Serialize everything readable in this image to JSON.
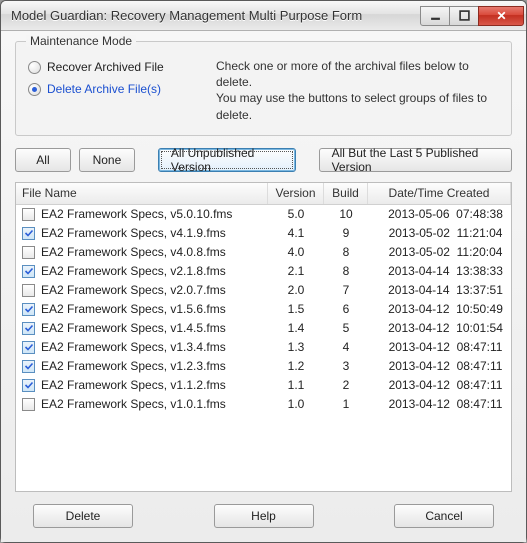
{
  "window": {
    "title": "Model Guardian: Recovery Management Multi Purpose Form"
  },
  "group": {
    "legend": "Maintenance Mode",
    "radio_recover": "Recover Archived File",
    "radio_delete": "Delete Archive File(s)",
    "selected": "delete",
    "instructions_line1": "Check one or more of the archival files below to delete.",
    "instructions_line2": "You may use the buttons to select groups of files to delete."
  },
  "filter_buttons": {
    "all": "All",
    "none": "None",
    "all_unpub": "All Unpublished Version",
    "all_but5": "All But the Last 5 Published Version"
  },
  "table": {
    "headers": {
      "filename": "File Name",
      "version": "Version",
      "build": "Build",
      "datetime": "Date/Time Created"
    },
    "rows": [
      {
        "checked": false,
        "filename": "EA2 Framework Specs, v5.0.10.fms",
        "version": "5.0",
        "build": "10",
        "datetime": "2013-05-06  07:48:38"
      },
      {
        "checked": true,
        "filename": "EA2 Framework Specs, v4.1.9.fms",
        "version": "4.1",
        "build": "9",
        "datetime": "2013-05-02  11:21:04"
      },
      {
        "checked": false,
        "filename": "EA2 Framework Specs, v4.0.8.fms",
        "version": "4.0",
        "build": "8",
        "datetime": "2013-05-02  11:20:04"
      },
      {
        "checked": true,
        "filename": "EA2 Framework Specs, v2.1.8.fms",
        "version": "2.1",
        "build": "8",
        "datetime": "2013-04-14  13:38:33"
      },
      {
        "checked": false,
        "filename": "EA2 Framework Specs, v2.0.7.fms",
        "version": "2.0",
        "build": "7",
        "datetime": "2013-04-14  13:37:51"
      },
      {
        "checked": true,
        "filename": "EA2 Framework Specs, v1.5.6.fms",
        "version": "1.5",
        "build": "6",
        "datetime": "2013-04-12  10:50:49"
      },
      {
        "checked": true,
        "filename": "EA2 Framework Specs, v1.4.5.fms",
        "version": "1.4",
        "build": "5",
        "datetime": "2013-04-12  10:01:54"
      },
      {
        "checked": true,
        "filename": "EA2 Framework Specs, v1.3.4.fms",
        "version": "1.3",
        "build": "4",
        "datetime": "2013-04-12  08:47:11"
      },
      {
        "checked": true,
        "filename": "EA2 Framework Specs, v1.2.3.fms",
        "version": "1.2",
        "build": "3",
        "datetime": "2013-04-12  08:47:11"
      },
      {
        "checked": true,
        "filename": "EA2 Framework Specs, v1.1.2.fms",
        "version": "1.1",
        "build": "2",
        "datetime": "2013-04-12  08:47:11"
      },
      {
        "checked": false,
        "filename": "EA2 Framework Specs, v1.0.1.fms",
        "version": "1.0",
        "build": "1",
        "datetime": "2013-04-12  08:47:11"
      }
    ]
  },
  "footer": {
    "delete": "Delete",
    "help": "Help",
    "cancel": "Cancel"
  }
}
